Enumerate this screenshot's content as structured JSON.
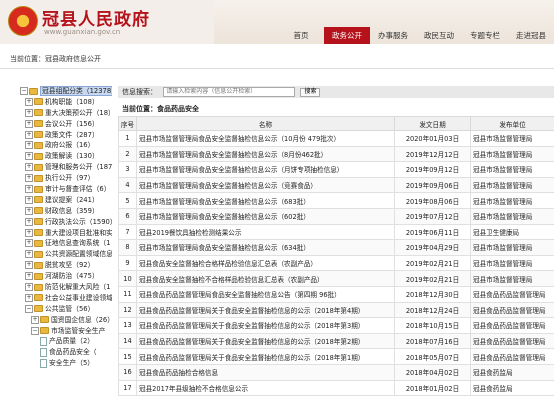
{
  "header": {
    "site_title": "冠县人民政府",
    "site_url": "www.guanxian.gov.cn",
    "nav": [
      "首页",
      "政务公开",
      "办事服务",
      "政民互动",
      "专题专栏",
      "走进冠县"
    ],
    "active_nav": "政务公开",
    "accent_color": "#b5121b"
  },
  "breadcrumb": {
    "label": "当前位置：",
    "home": "冠县政府信息公开"
  },
  "sidebar": {
    "items": [
      {
        "label": "冠县组配分类（12378）",
        "type": "root"
      },
      {
        "label": "机构职能（108）",
        "type": "folder"
      },
      {
        "label": "重大决策预公开（18）",
        "type": "folder"
      },
      {
        "label": "会议公开（156）",
        "type": "folder"
      },
      {
        "label": "政策文件（287）",
        "type": "folder"
      },
      {
        "label": "政府公报（16）",
        "type": "folder"
      },
      {
        "label": "政策解读（130）",
        "type": "folder"
      },
      {
        "label": "管理和服务公开（187",
        "type": "folder"
      },
      {
        "label": "执行公开（97）",
        "type": "folder"
      },
      {
        "label": "审计与督查评估（6）",
        "type": "folder"
      },
      {
        "label": "建议提案（241）",
        "type": "folder"
      },
      {
        "label": "财政信息（359）",
        "type": "folder"
      },
      {
        "label": "行政执法公示（1590）",
        "type": "folder"
      },
      {
        "label": "重大建设项目批准和实",
        "type": "folder"
      },
      {
        "label": "征地信息查询系统（1",
        "type": "folder"
      },
      {
        "label": "公共资源配置领域信息",
        "type": "folder"
      },
      {
        "label": "脱贫攻坚（92）",
        "type": "folder"
      },
      {
        "label": "河湖防治（475）",
        "type": "folder"
      },
      {
        "label": "防范化解重大风险（1",
        "type": "folder"
      },
      {
        "label": "社会公益事业建设领域",
        "type": "folder"
      },
      {
        "label": "公共监管（56）",
        "type": "folder-open"
      },
      {
        "label": "国资国企信息（26）",
        "type": "sub-folder"
      },
      {
        "label": "市场监管安全生产",
        "type": "sub-folder-open"
      },
      {
        "label": "产品质量（2）",
        "type": "doc"
      },
      {
        "label": "食品药品安全（",
        "type": "doc"
      },
      {
        "label": "安全生产（5）",
        "type": "doc"
      }
    ]
  },
  "search": {
    "label": "信息搜索：",
    "placeholder": "请输入检索内容（信息公开检索）",
    "button": "搜索"
  },
  "location": "当前位置：食品药品安全",
  "table": {
    "headers": [
      "序号",
      "名称",
      "发文日期",
      "发布单位"
    ],
    "rows": [
      [
        "1",
        "冠县市场监督管理局食品安全监督抽检信息公示（10月份 479批次）",
        "2020年01月03日",
        "冠县市场监督管理局"
      ],
      [
        "2",
        "冠县市场监督管理局食品安全监督抽检信息公示（8月份462批）",
        "2019年12月12日",
        "冠县市场监督管理局"
      ],
      [
        "3",
        "冠县市场监督管理局食品安全监督抽检信息公示（月饼专项抽检信息）",
        "2019年09月12日",
        "冠县市场监督管理局"
      ],
      [
        "4",
        "冠县市场监督管理局食品安全监督抽检信息公示（竞赛食品）",
        "2019年09月06日",
        "冠县市场监督管理局"
      ],
      [
        "5",
        "冠县市场监督管理局食品安全监督抽检信息公示（683批）",
        "2019年08月06日",
        "冠县市场监督管理局"
      ],
      [
        "6",
        "冠县市场监督管理局食品安全监督抽检信息公示（602批）",
        "2019年07月12日",
        "冠县市场监督管理局"
      ],
      [
        "7",
        "冠县2019餐饮具抽检检测结果公示",
        "2019年06月11日",
        "冠县卫生健康局"
      ],
      [
        "8",
        "冠县市场监督管理局食品安全监督抽检信息公示（634批）",
        "2019年04月29日",
        "冠县市场监督管理局"
      ],
      [
        "9",
        "冠县食品安全监督抽检合格样品检验信息汇总表（农副产品）",
        "2019年02月21日",
        "冠县市场监督管理局"
      ],
      [
        "10",
        "冠县食品安全监督抽检不合格样品检验信息汇总表（农副产品）",
        "2019年02月21日",
        "冠县市场监督管理局"
      ],
      [
        "11",
        "冠县食品药品监督管理局食品安全监督抽检信息公告（第四期 96批）",
        "2018年12月30日",
        "冠县食品药品监督管理局"
      ],
      [
        "12",
        "冠县食品药品监督管理局关于食品安全监督抽检信息的公示（2018年第4期）",
        "2018年12月24日",
        "冠县食品药品监督管理局"
      ],
      [
        "13",
        "冠县食品药品监督管理局关于食品安全监督抽检信息的公示（2018年第3期）",
        "2018年10月15日",
        "冠县食品药品监督管理局"
      ],
      [
        "14",
        "冠县食品药品监督管理局关于食品安全监督抽检信息的公示（2018年第2期）",
        "2018年07月16日",
        "冠县食品药品监督管理局"
      ],
      [
        "15",
        "冠县食品药品监督管理局关于食品安全监督抽检信息的公示（2018年第1期）",
        "2018年05月07日",
        "冠县食品药品监督管理局"
      ],
      [
        "16",
        "冠县食品药品抽检合格信息",
        "2018年04月02日",
        "冠县食药监局"
      ],
      [
        "17",
        "冠县2017年县级抽检不合格信息公示",
        "2018年01月02日",
        "冠县食药监局"
      ]
    ]
  }
}
